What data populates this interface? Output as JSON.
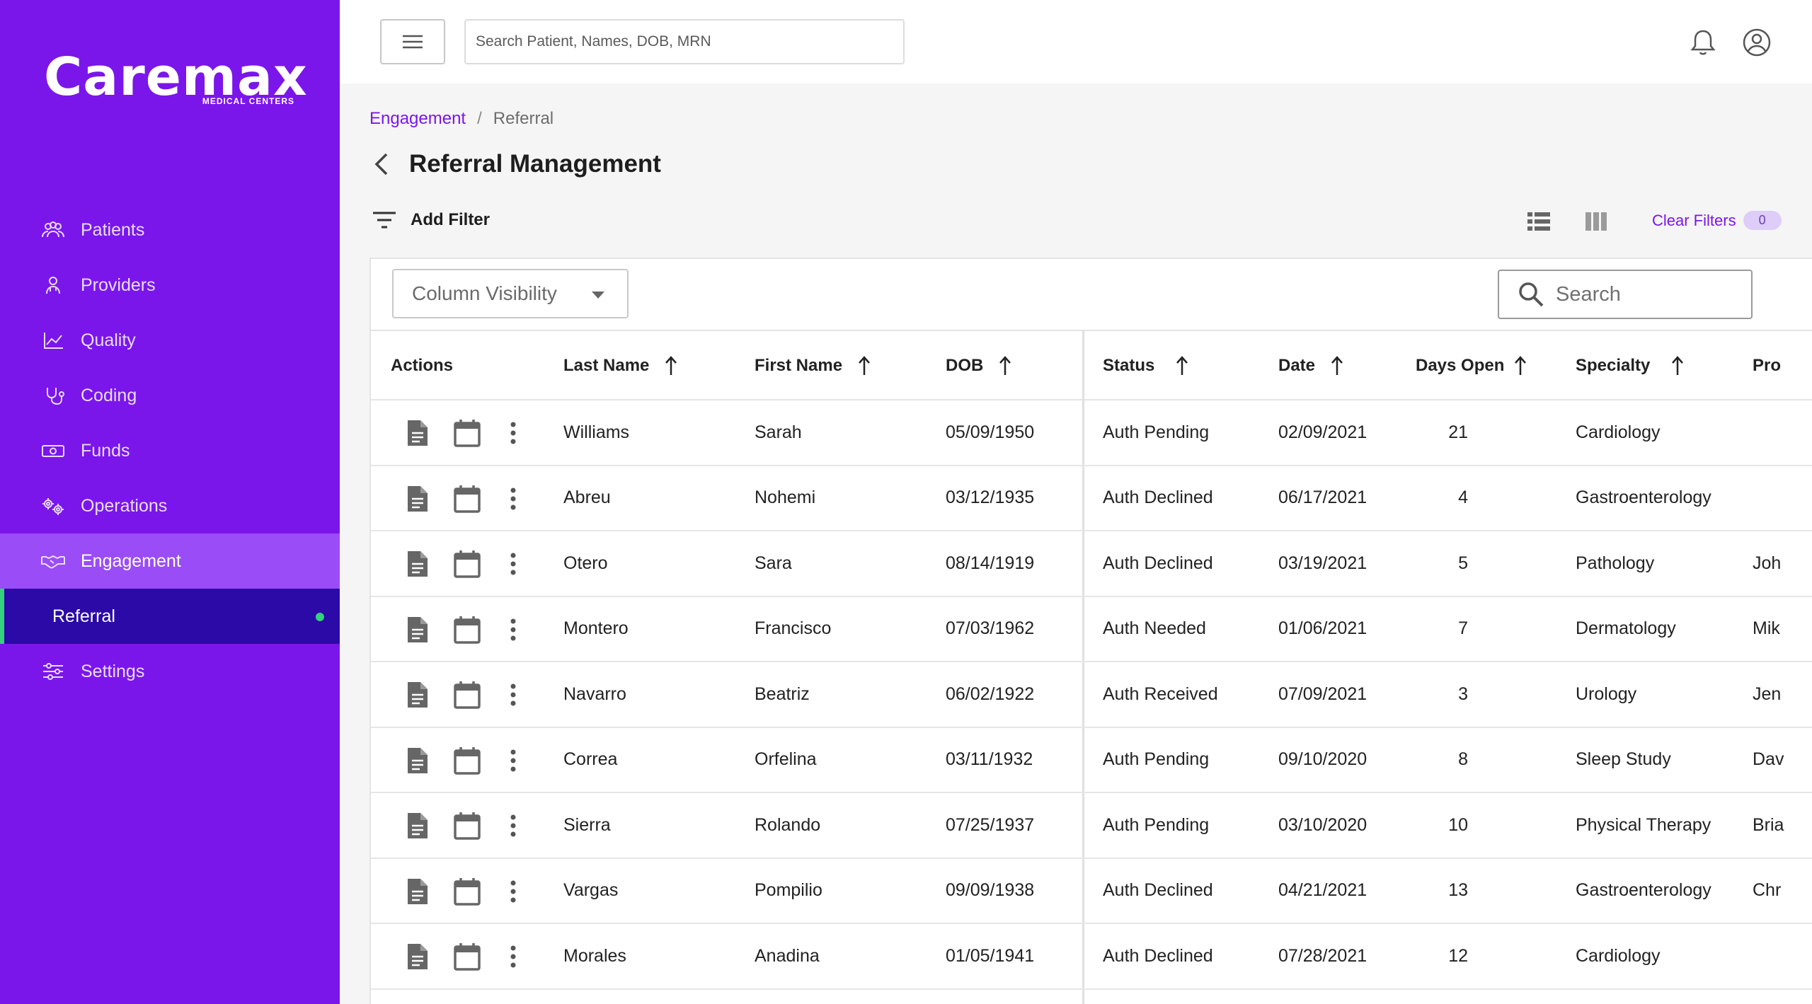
{
  "brand": {
    "logo_text": "Caremax",
    "logo_sub": "MEDICAL CENTERS"
  },
  "sidebar": {
    "items": [
      {
        "label": "Patients",
        "icon": "people-icon"
      },
      {
        "label": "Providers",
        "icon": "provider-icon"
      },
      {
        "label": "Quality",
        "icon": "chart-line-icon"
      },
      {
        "label": "Coding",
        "icon": "stethoscope-icon"
      },
      {
        "label": "Funds",
        "icon": "money-icon"
      },
      {
        "label": "Operations",
        "icon": "gears-icon"
      },
      {
        "label": "Engagement",
        "icon": "handshake-icon",
        "active": true
      }
    ],
    "sub_item": {
      "label": "Referral"
    },
    "settings": {
      "label": "Settings",
      "icon": "sliders-icon"
    },
    "colors": {
      "background": "#7a16ea",
      "active": "#9a4cf7",
      "sub_active": "#2b0aa8",
      "indicator": "#33d17a"
    }
  },
  "topbar": {
    "search_placeholder": "Search Patient, Names, DOB, MRN"
  },
  "breadcrumb": {
    "parent": "Engagement",
    "separator": "/",
    "current": "Referral"
  },
  "page": {
    "title": "Referral Management"
  },
  "toolbar": {
    "add_filter": "Add Filter",
    "clear_filters": "Clear Filters",
    "filter_count": "0"
  },
  "table": {
    "column_visibility": "Column Visibility",
    "search_placeholder": "Search",
    "headers": {
      "actions": "Actions",
      "last_name": "Last Name",
      "first_name": "First Name",
      "dob": "DOB",
      "status": "Status",
      "date": "Date",
      "days_open": "Days Open",
      "specialty": "Specialty",
      "provider": "Pro"
    },
    "rows": [
      {
        "last": "Williams",
        "first": "Sarah",
        "dob": "05/09/1950",
        "status": "Auth Pending",
        "date": "02/09/2021",
        "days": "21",
        "specialty": "Cardiology",
        "provider": ""
      },
      {
        "last": "Abreu",
        "first": "Nohemi",
        "dob": "03/12/1935",
        "status": "Auth Declined",
        "date": "06/17/2021",
        "days": "4",
        "specialty": "Gastroenterology",
        "provider": ""
      },
      {
        "last": "Otero",
        "first": "Sara",
        "dob": "08/14/1919",
        "status": "Auth Declined",
        "date": "03/19/2021",
        "days": "5",
        "specialty": "Pathology",
        "provider": "Joh"
      },
      {
        "last": "Montero",
        "first": "Francisco",
        "dob": "07/03/1962",
        "status": "Auth Needed",
        "date": "01/06/2021",
        "days": "7",
        "specialty": "Dermatology",
        "provider": "Mik"
      },
      {
        "last": "Navarro",
        "first": "Beatriz",
        "dob": "06/02/1922",
        "status": "Auth Received",
        "date": "07/09/2021",
        "days": "3",
        "specialty": "Urology",
        "provider": "Jen"
      },
      {
        "last": "Correa",
        "first": "Orfelina",
        "dob": "03/11/1932",
        "status": "Auth Pending",
        "date": "09/10/2020",
        "days": "8",
        "specialty": "Sleep Study",
        "provider": "Dav"
      },
      {
        "last": "Sierra",
        "first": "Rolando",
        "dob": "07/25/1937",
        "status": "Auth Pending",
        "date": "03/10/2020",
        "days": "10",
        "specialty": "Physical Therapy",
        "provider": "Bria"
      },
      {
        "last": "Vargas",
        "first": "Pompilio",
        "dob": "09/09/1938",
        "status": "Auth Declined",
        "date": "04/21/2021",
        "days": "13",
        "specialty": "Gastroenterology",
        "provider": "Chr"
      },
      {
        "last": "Morales",
        "first": "Anadina",
        "dob": "01/05/1941",
        "status": "Auth Declined",
        "date": "07/28/2021",
        "days": "12",
        "specialty": "Cardiology",
        "provider": ""
      }
    ]
  }
}
